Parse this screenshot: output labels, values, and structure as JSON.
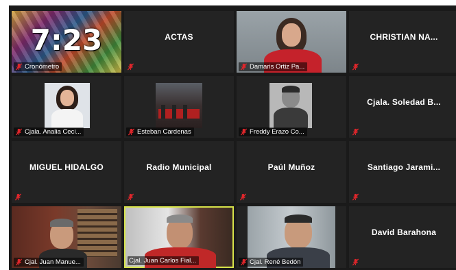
{
  "participants": [
    {
      "name": "Cronómetro",
      "clock": "7:23"
    },
    {
      "name": "ACTAS"
    },
    {
      "name": "Damaris Ortiz Pa..."
    },
    {
      "name": "CHRISTIAN NA..."
    },
    {
      "name": "Cjala. Analia Ceci..."
    },
    {
      "name": "Esteban Cardenas"
    },
    {
      "name": "Freddy Erazo Co..."
    },
    {
      "name": "Cjala.  Soledad  B..."
    },
    {
      "name": "MIGUEL HIDALGO"
    },
    {
      "name": "Radio Municipal"
    },
    {
      "name": "Paúl Muñoz"
    },
    {
      "name": "Santiago  Jarami..."
    },
    {
      "name": "Cjal. Juan Manue..."
    },
    {
      "name": "Cjal. Juan Carlos Fial..."
    },
    {
      "name": "Cjal. René Bedón"
    },
    {
      "name": "David Barahona"
    }
  ],
  "icons": {
    "muted": "mic-muted-icon"
  },
  "colors": {
    "muted": "#e0262b",
    "speaking_border": "#d7e34a",
    "tile_bg": "#232323"
  }
}
